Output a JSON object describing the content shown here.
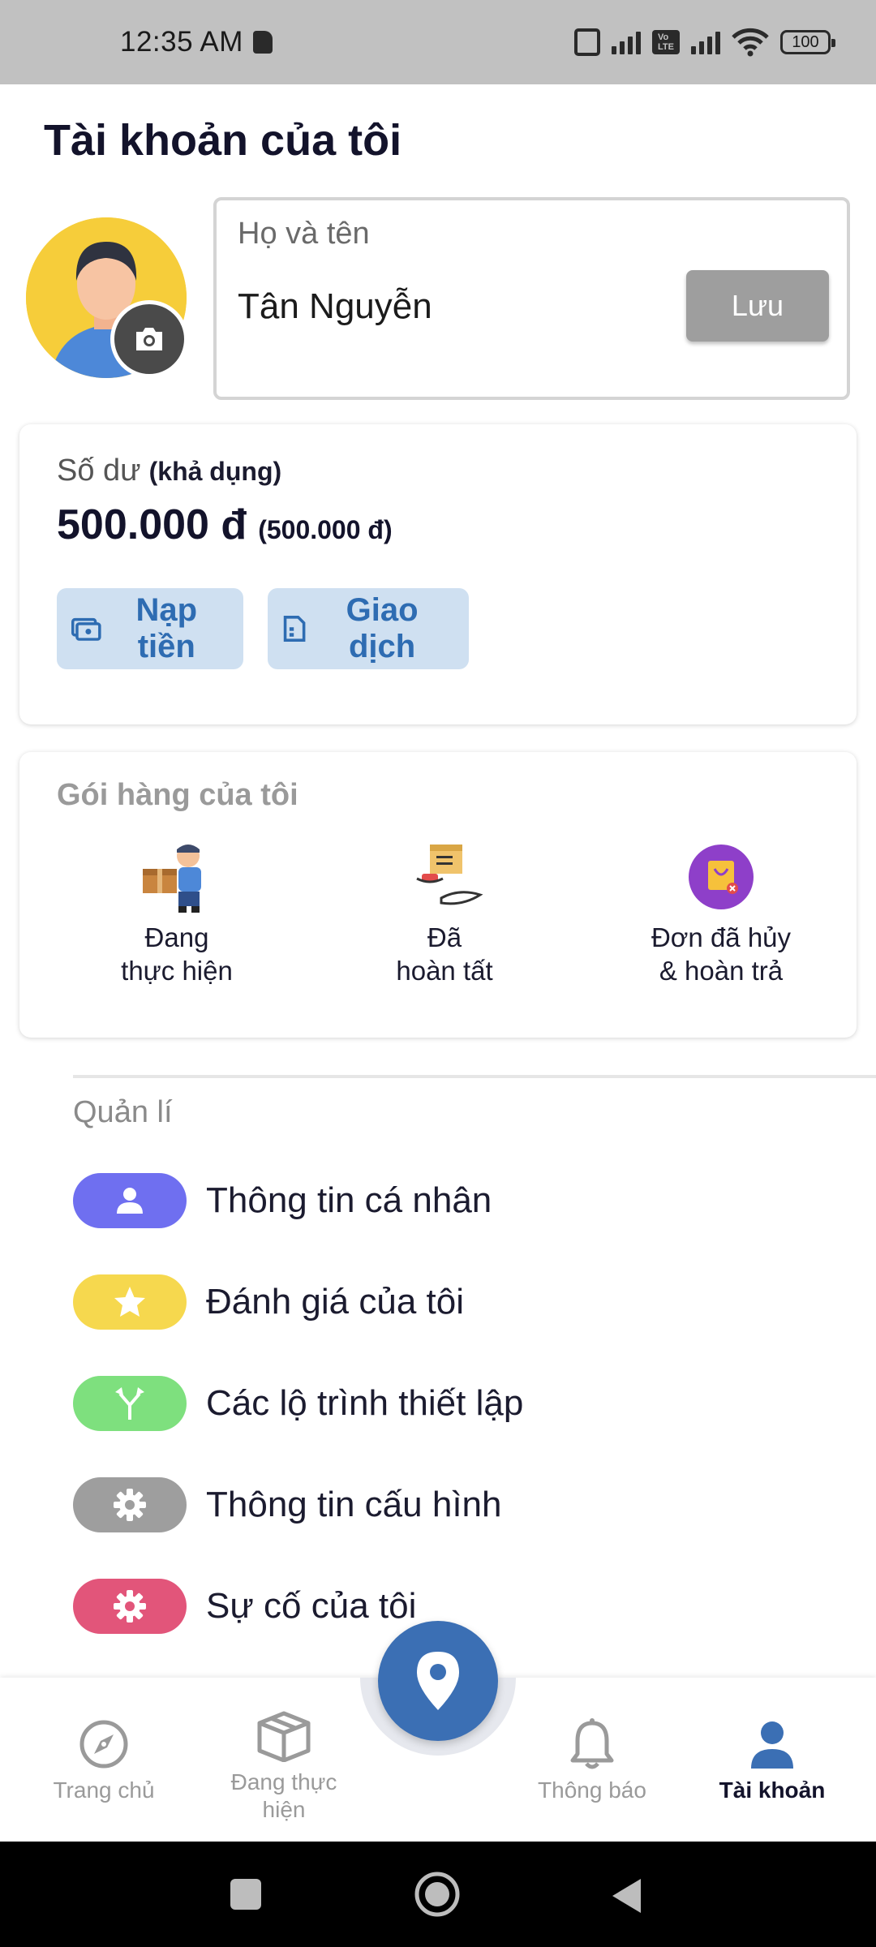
{
  "status_bar": {
    "time": "12:35 AM",
    "battery": "100",
    "volte": "Vo LTE"
  },
  "page": {
    "title": "Tài khoản của tôi"
  },
  "profile": {
    "name_label": "Họ và tên",
    "name_value": "Tân Nguyễn",
    "save_label": "Lưu"
  },
  "balance": {
    "label": "Số dư",
    "sub_label": "(khả dụng)",
    "amount": "500.000 đ",
    "amount_sub": "(500.000 đ)",
    "topup_label": "Nạp tiền",
    "transactions_label": "Giao dịch"
  },
  "packages": {
    "title": "Gói hàng của tôi",
    "items": [
      {
        "label": "Đang\nthực hiện",
        "icon": "delivery-man-icon"
      },
      {
        "label": "Đã\nhoàn tất",
        "icon": "package-handover-icon"
      },
      {
        "label": "Đơn đã hủy\n& hoàn trả",
        "icon": "cancelled-bag-icon"
      }
    ]
  },
  "management": {
    "title": "Quản lí",
    "items": [
      {
        "label": "Thông tin cá nhân",
        "icon": "person-icon",
        "color": "#6f6ff0"
      },
      {
        "label": "Đánh giá của tôi",
        "icon": "star-icon",
        "color": "#f6d84e"
      },
      {
        "label": "Các lộ trình thiết lập",
        "icon": "route-split-icon",
        "color": "#7ee07e"
      },
      {
        "label": "Thông tin cấu hình",
        "icon": "gear-icon",
        "color": "#9e9e9e"
      },
      {
        "label": "Sự cố của tôi",
        "icon": "gear-icon",
        "color": "#e2557a"
      }
    ]
  },
  "bottom_nav": {
    "items": [
      {
        "label": "Trang chủ",
        "icon": "compass-icon"
      },
      {
        "label": "Đang thực\nhiện",
        "icon": "box-icon"
      },
      {
        "label": "Thông báo",
        "icon": "bell-icon"
      },
      {
        "label": "Tài khoản",
        "icon": "person-icon",
        "active": true
      }
    ],
    "fab_icon": "location-pin-icon"
  },
  "colors": {
    "primary": "#3b6fb4",
    "button_bg": "#cfe0f1"
  }
}
